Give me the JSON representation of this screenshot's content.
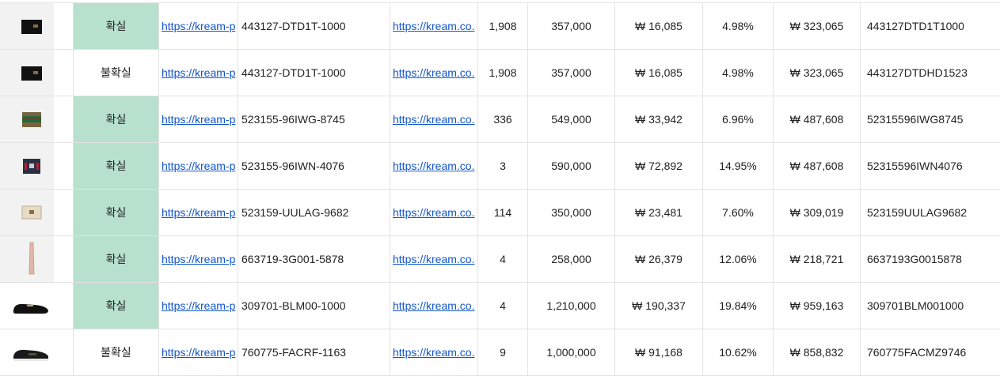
{
  "rows": [
    {
      "icon": "black-wallet-icon",
      "status": "확실",
      "verified": true,
      "link1": "https://kream-p",
      "code": "443127-DTD1T-1000",
      "link2": "https://kream.co.",
      "n1": "1,908",
      "n2": "357,000",
      "n3": "₩ 16,085",
      "n4": "4.98%",
      "n5": "₩ 323,065",
      "sku": "443127DTD1T1000"
    },
    {
      "icon": "black-wallet-icon",
      "status": "불확실",
      "verified": false,
      "link1": "https://kream-p",
      "code": "443127-DTD1T-1000",
      "link2": "https://kream.co.",
      "n1": "1,908",
      "n2": "357,000",
      "n3": "₩ 16,085",
      "n4": "4.98%",
      "n5": "₩ 323,065",
      "sku": "443127DTDHD1523"
    },
    {
      "icon": "web-stripe-wallet-icon",
      "status": "확실",
      "verified": true,
      "link1": "https://kream-p",
      "code": "523155-96IWG-8745",
      "link2": "https://kream.co.",
      "n1": "336",
      "n2": "549,000",
      "n3": "₩ 33,942",
      "n4": "6.96%",
      "n5": "₩ 487,608",
      "sku": "52315596IWG8745"
    },
    {
      "icon": "navy-wallet-icon",
      "status": "확실",
      "verified": true,
      "link1": "https://kream-p",
      "code": "523155-96IWN-4076",
      "link2": "https://kream.co.",
      "n1": "3",
      "n2": "590,000",
      "n3": "₩ 72,892",
      "n4": "14.95%",
      "n5": "₩ 487,608",
      "sku": "52315596IWN4076"
    },
    {
      "icon": "beige-wallet-icon",
      "status": "확실",
      "verified": true,
      "link1": "https://kream-p",
      "code": "523159-UULAG-9682",
      "link2": "https://kream.co.",
      "n1": "114",
      "n2": "350,000",
      "n3": "₩ 23,481",
      "n4": "7.60%",
      "n5": "₩ 309,019",
      "sku": "523159UULAG9682"
    },
    {
      "icon": "pink-strap-icon",
      "status": "확실",
      "verified": true,
      "link1": "https://kream-p",
      "code": "663719-3G001-5878",
      "link2": "https://kream.co.",
      "n1": "4",
      "n2": "258,000",
      "n3": "₩ 26,379",
      "n4": "12.06%",
      "n5": "₩ 218,721",
      "sku": "6637193G0015878"
    },
    {
      "icon": "black-loafer-icon",
      "status": "확실",
      "verified": true,
      "link1": "https://kream-p",
      "code": "309701-BLM00-1000",
      "link2": "https://kream.co.",
      "n1": "4",
      "n2": "1,210,000",
      "n3": "₩ 190,337",
      "n4": "19.84%",
      "n5": "₩ 959,163",
      "sku": "309701BLM001000"
    },
    {
      "icon": "black-sneaker-icon",
      "status": "불확실",
      "verified": false,
      "link1": "https://kream-p",
      "code": "760775-FACRF-1163",
      "link2": "https://kream.co.",
      "n1": "9",
      "n2": "1,000,000",
      "n3": "₩ 91,168",
      "n4": "10.62%",
      "n5": "₩ 858,832",
      "sku": "760775FACMZ9746"
    }
  ],
  "colors": {
    "verified_bg": "#b7e1cd",
    "link": "#1155cc",
    "grid": "#e3e3e3"
  }
}
